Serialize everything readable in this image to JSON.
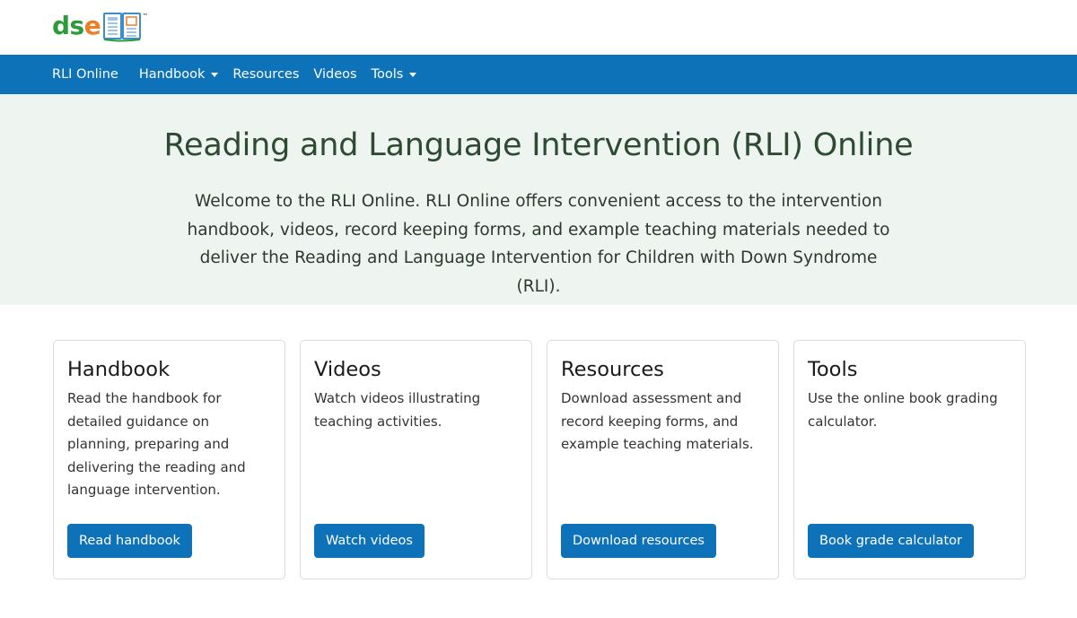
{
  "logo": {
    "d": "d",
    "s": "s",
    "e": "e",
    "tm": "™"
  },
  "nav": {
    "items": [
      {
        "label": "RLI Online"
      },
      {
        "label": "Handbook"
      },
      {
        "label": "Resources"
      },
      {
        "label": "Videos"
      },
      {
        "label": "Tools"
      }
    ]
  },
  "hero": {
    "title": "Reading and Language Intervention (RLI) Online",
    "intro": "Welcome to the RLI Online. RLI Online offers convenient access to the intervention handbook, videos, record keeping forms, and example teaching materials needed to deliver the Reading and Language Intervention for Children with Down Syndrome (RLI)."
  },
  "cards": [
    {
      "title": "Handbook",
      "text": "Read the handbook for detailed guidance on planning, preparing and delivering the reading and language intervention.",
      "button": "Read handbook"
    },
    {
      "title": "Videos",
      "text": "Watch videos illustrating teaching activities.",
      "button": "Watch videos"
    },
    {
      "title": "Resources",
      "text": "Download assessment and record keeping forms, and example teaching materials.",
      "button": "Download resources"
    },
    {
      "title": "Tools",
      "text": "Use the online book grading calculator.",
      "button": "Book grade calculator"
    }
  ],
  "colors": {
    "nav": "#0e72b8",
    "hero_bg": "#eef4ef",
    "logo_green": "#2e9b3a",
    "logo_orange": "#ef7d22"
  }
}
